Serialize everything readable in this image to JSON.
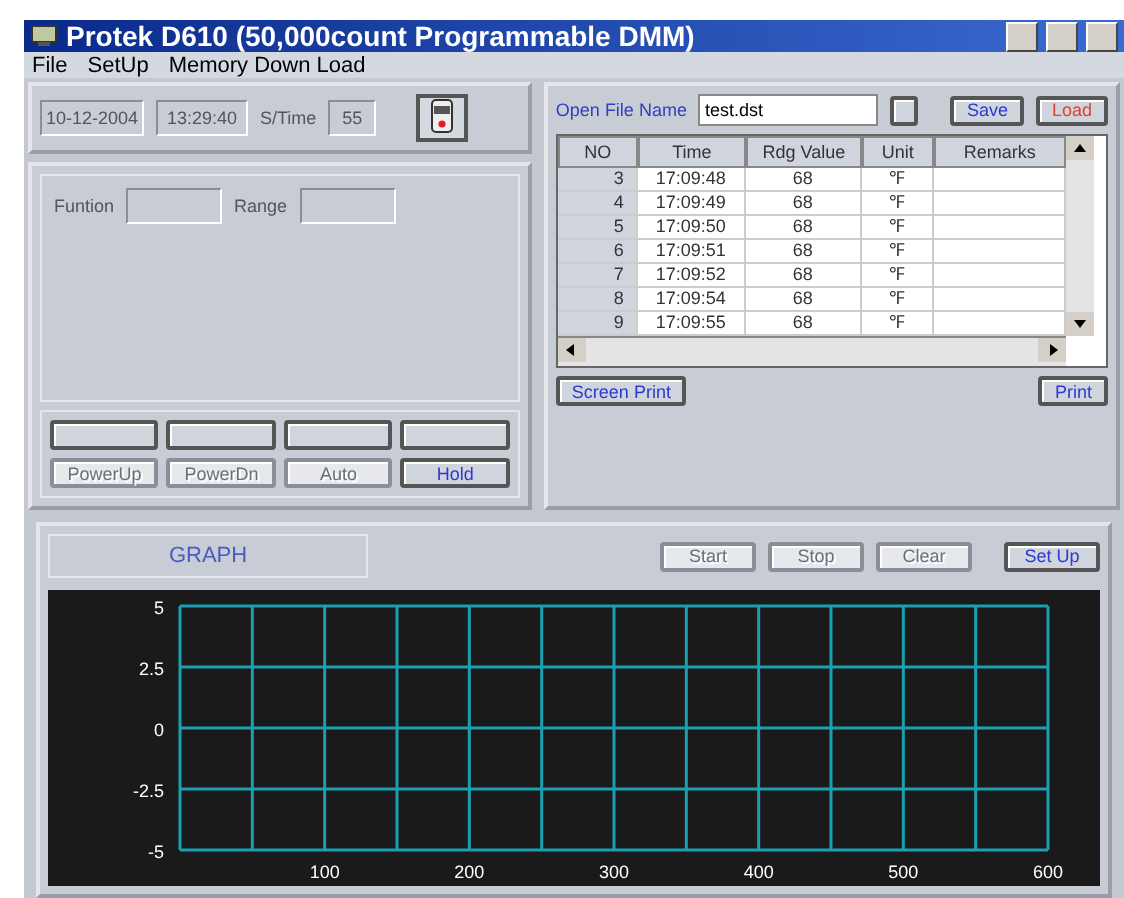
{
  "window": {
    "title": "Protek D610 (50,000count Programmable DMM)"
  },
  "menu": [
    "File",
    "SetUp",
    "Memory Down Load"
  ],
  "status": {
    "date": "10-12-2004",
    "time": "13:29:40",
    "stime_label": "S/Time",
    "stime": "55"
  },
  "display": {
    "function_label": "Funtion",
    "range_label": "Range"
  },
  "keys": [
    {
      "disabled": false
    },
    {
      "disabled": false
    },
    {
      "disabled": false
    },
    {
      "disabled": false
    },
    {
      "label": "PowerUp",
      "disabled": true
    },
    {
      "label": "PowerDn",
      "disabled": true
    },
    {
      "label": "Auto",
      "disabled": true
    },
    {
      "label": "Hold",
      "disabled": false
    }
  ],
  "file": {
    "label": "Open File Name",
    "value": "test.dst",
    "save": "Save",
    "load": "Load"
  },
  "table": {
    "columns": [
      "NO",
      "Time",
      "Rdg Value",
      "Unit",
      "Remarks"
    ],
    "rows": [
      [
        "3",
        "17:09:48",
        "68",
        "℉",
        ""
      ],
      [
        "4",
        "17:09:49",
        "68",
        "℉",
        ""
      ],
      [
        "5",
        "17:09:50",
        "68",
        "℉",
        ""
      ],
      [
        "6",
        "17:09:51",
        "68",
        "℉",
        ""
      ],
      [
        "7",
        "17:09:52",
        "68",
        "℉",
        ""
      ],
      [
        "8",
        "17:09:54",
        "68",
        "℉",
        ""
      ],
      [
        "9",
        "17:09:55",
        "68",
        "℉",
        ""
      ]
    ]
  },
  "print_buttons": [
    "Screen Print",
    "Print"
  ],
  "graph": {
    "title": "GRAPH",
    "buttons": [
      {
        "label": "Start",
        "disabled": true
      },
      {
        "label": "Stop",
        "disabled": true
      },
      {
        "label": "Clear",
        "disabled": true
      },
      {
        "label": "Set Up",
        "disabled": false
      }
    ],
    "chart_data": {
      "type": "line",
      "grid": true,
      "xlim": [
        0,
        600
      ],
      "ylim": [
        -5,
        5
      ],
      "xticks": [
        100,
        200,
        300,
        400,
        500,
        600
      ],
      "yticks": [
        5,
        2.5,
        0,
        -2.5,
        -5
      ]
    }
  }
}
